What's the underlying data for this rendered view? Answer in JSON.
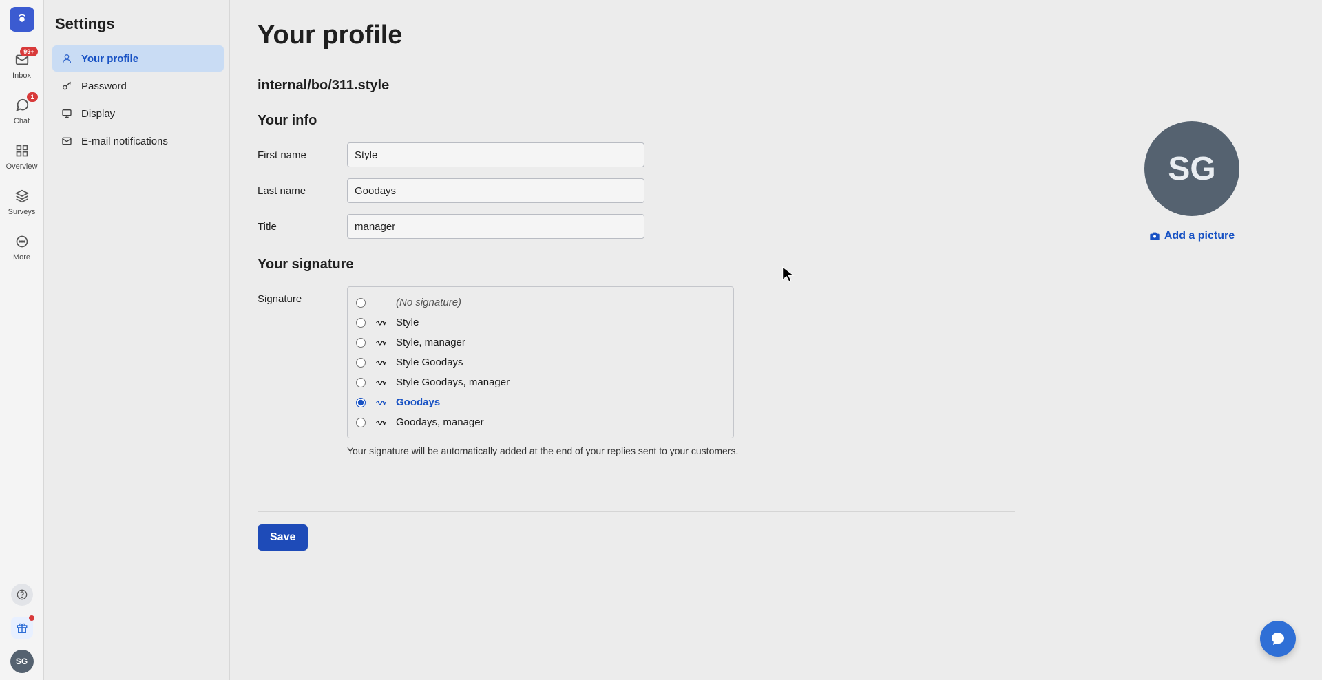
{
  "rail": {
    "items": [
      {
        "label": "Inbox",
        "badge": "99+"
      },
      {
        "label": "Chat",
        "badge": "1"
      },
      {
        "label": "Overview",
        "badge": null
      },
      {
        "label": "Surveys",
        "badge": null
      },
      {
        "label": "More",
        "badge": null
      }
    ],
    "avatar_initials": "SG"
  },
  "sidebar": {
    "title": "Settings",
    "items": [
      {
        "label": "Your profile"
      },
      {
        "label": "Password"
      },
      {
        "label": "Display"
      },
      {
        "label": "E-mail notifications"
      }
    ]
  },
  "profile": {
    "page_title": "Your profile",
    "subpath": "internal/bo/311.style",
    "info_heading": "Your info",
    "signature_heading": "Your signature",
    "labels": {
      "first_name": "First name",
      "last_name": "Last name",
      "title": "Title",
      "signature": "Signature"
    },
    "values": {
      "first_name": "Style",
      "last_name": "Goodays",
      "title": "manager"
    },
    "signature_options": [
      {
        "text": "(No signature)",
        "no_glyph": true,
        "italic": true
      },
      {
        "text": "Style"
      },
      {
        "text": "Style, manager"
      },
      {
        "text": "Style Goodays"
      },
      {
        "text": "Style Goodays, manager"
      },
      {
        "text": "Goodays",
        "selected": true
      },
      {
        "text": "Goodays, manager"
      }
    ],
    "signature_help": "Your signature will be automatically added at the end of your replies sent to your customers.",
    "save_label": "Save"
  },
  "avatar_panel": {
    "initials": "SG",
    "add_picture_label": "Add a picture"
  }
}
